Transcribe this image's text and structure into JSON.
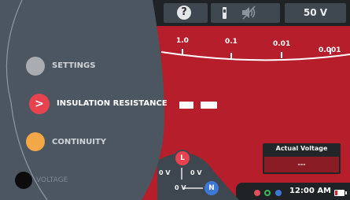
{
  "top_bar": {
    "help_icon": "help-icon",
    "help_glyph": "?",
    "probe_icon": "probe-icon",
    "mute_icon": "mute-icon",
    "test_voltage": "50 V"
  },
  "scale": {
    "labels": [
      "1.0",
      "0.1",
      "0.01",
      "0.001"
    ]
  },
  "menu": {
    "items": [
      {
        "label": "SETTINGS",
        "icon": "settings-dot",
        "color": "#a9adb1",
        "selected": false
      },
      {
        "label": "INSULATION RESISTANCE",
        "icon": "chevron-right-icon",
        "glyph": ">",
        "color": "#e8424f",
        "selected": true
      },
      {
        "label": "CONTINUITY",
        "icon": "continuity-dot",
        "color": "#f3a746",
        "selected": false
      },
      {
        "label": "VOLTAGE",
        "icon": "voltage-dot",
        "color": "#0c0c0c",
        "selected": false
      }
    ]
  },
  "terminals": {
    "red_label": "L",
    "blue_label": "N",
    "left_reading": "0 V",
    "right_reading": "0 V",
    "lower_reading": "0 V"
  },
  "actual_voltage": {
    "title": "Actual Voltage",
    "value": "---"
  },
  "bottom_bar": {
    "indicators": [
      "red",
      "green",
      "blue"
    ],
    "time": "12:00 AM",
    "battery_icon": "battery-low-icon"
  },
  "colors": {
    "background": "#b51e2a",
    "panel": "#4a5560",
    "bar": "#1f2326"
  }
}
